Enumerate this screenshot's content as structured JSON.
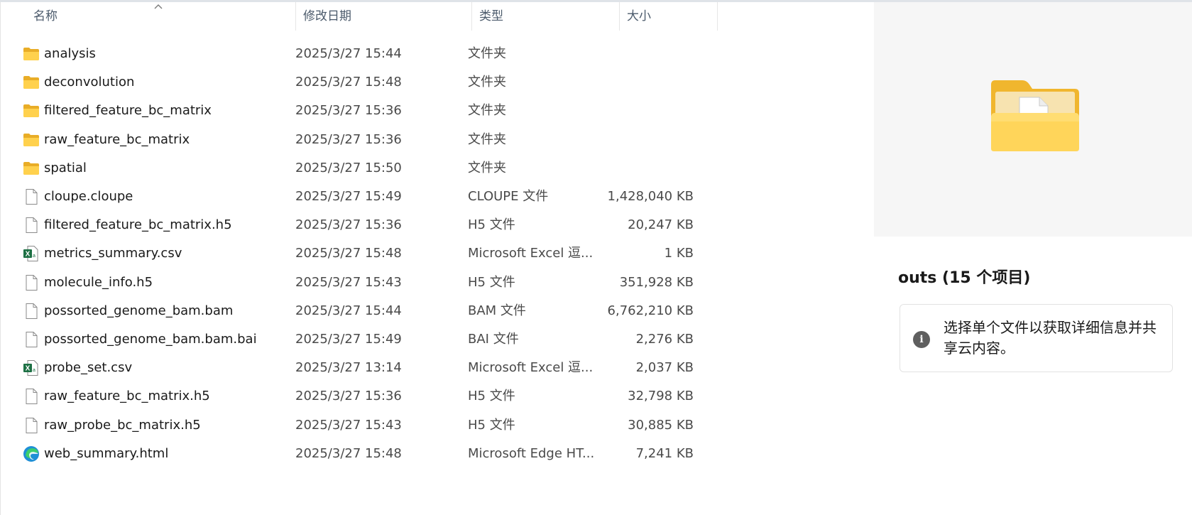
{
  "columns": {
    "name": "名称",
    "date": "修改日期",
    "type": "类型",
    "size": "大小"
  },
  "files": [
    {
      "name": "analysis",
      "date": "2025/3/27 15:44",
      "type": "文件夹",
      "size": "",
      "icon": "folder-icon"
    },
    {
      "name": "deconvolution",
      "date": "2025/3/27 15:48",
      "type": "文件夹",
      "size": "",
      "icon": "folder-icon"
    },
    {
      "name": "filtered_feature_bc_matrix",
      "date": "2025/3/27 15:36",
      "type": "文件夹",
      "size": "",
      "icon": "folder-icon"
    },
    {
      "name": "raw_feature_bc_matrix",
      "date": "2025/3/27 15:36",
      "type": "文件夹",
      "size": "",
      "icon": "folder-icon"
    },
    {
      "name": "spatial",
      "date": "2025/3/27 15:50",
      "type": "文件夹",
      "size": "",
      "icon": "folder-icon"
    },
    {
      "name": "cloupe.cloupe",
      "date": "2025/3/27 15:49",
      "type": "CLOUPE 文件",
      "size": "1,428,040 KB",
      "icon": "file-icon"
    },
    {
      "name": "filtered_feature_bc_matrix.h5",
      "date": "2025/3/27 15:36",
      "type": "H5 文件",
      "size": "20,247 KB",
      "icon": "file-icon"
    },
    {
      "name": "metrics_summary.csv",
      "date": "2025/3/27 15:48",
      "type": "Microsoft Excel 逗...",
      "size": "1 KB",
      "icon": "excel-icon"
    },
    {
      "name": "molecule_info.h5",
      "date": "2025/3/27 15:43",
      "type": "H5 文件",
      "size": "351,928 KB",
      "icon": "file-icon"
    },
    {
      "name": "possorted_genome_bam.bam",
      "date": "2025/3/27 15:44",
      "type": "BAM 文件",
      "size": "6,762,210 KB",
      "icon": "file-icon"
    },
    {
      "name": "possorted_genome_bam.bam.bai",
      "date": "2025/3/27 15:49",
      "type": "BAI 文件",
      "size": "2,276 KB",
      "icon": "file-icon"
    },
    {
      "name": "probe_set.csv",
      "date": "2025/3/27 13:14",
      "type": "Microsoft Excel 逗...",
      "size": "2,037 KB",
      "icon": "excel-icon"
    },
    {
      "name": "raw_feature_bc_matrix.h5",
      "date": "2025/3/27 15:36",
      "type": "H5 文件",
      "size": "32,798 KB",
      "icon": "file-icon"
    },
    {
      "name": "raw_probe_bc_matrix.h5",
      "date": "2025/3/27 15:43",
      "type": "H5 文件",
      "size": "30,885 KB",
      "icon": "file-icon"
    },
    {
      "name": "web_summary.html",
      "date": "2025/3/27 15:48",
      "type": "Microsoft Edge HT...",
      "size": "7,241 KB",
      "icon": "edge-icon"
    }
  ],
  "details": {
    "title": "outs (15 个项目)",
    "info": "选择单个文件以获取详细信息并共享云内容。",
    "info_icon": "i"
  },
  "colors": {
    "folder": "#f8c940",
    "excel": "#1d7044",
    "edge": "#1f8fd6",
    "header_text": "#4b5a6b"
  }
}
